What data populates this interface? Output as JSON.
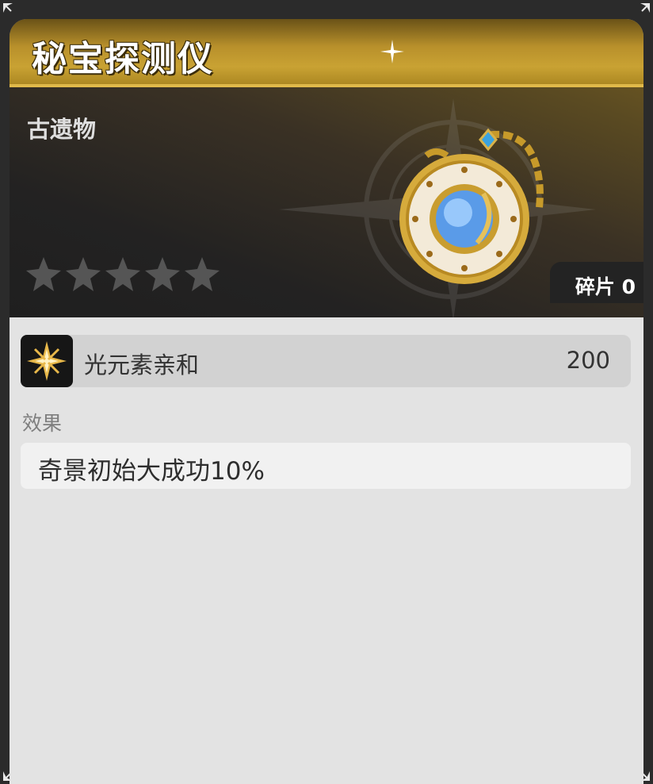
{
  "item": {
    "name": "秘宝探测仪",
    "category": "古遗物",
    "stars_total": 5,
    "stars_filled": 0,
    "fragments_label": "碎片 0"
  },
  "attribute": {
    "icon": "light-element-star-icon",
    "label": "光元素亲和",
    "value": "200"
  },
  "effect": {
    "section_label": "效果",
    "text": "奇景初始大成功10%"
  },
  "colors": {
    "gold_accent": "#c9a233",
    "panel_bg": "#e3e3e3",
    "header_dark": "#232222",
    "star_empty": "#555555"
  }
}
